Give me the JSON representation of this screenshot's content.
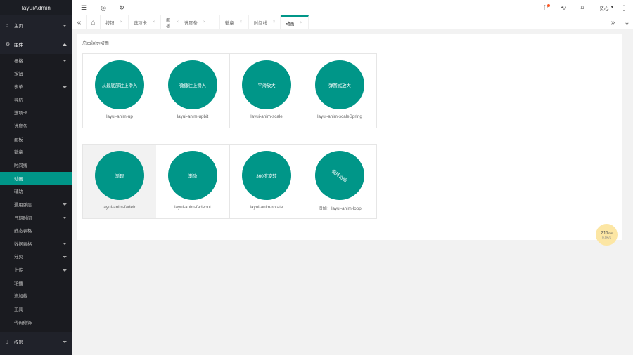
{
  "app": {
    "title": "layuiAdmin"
  },
  "sidebar": {
    "home_label": "主页",
    "components_label": "组件",
    "permissions_label": "权限",
    "items": [
      {
        "label": "栅格",
        "expandable": true
      },
      {
        "label": "按钮",
        "expandable": false
      },
      {
        "label": "表单",
        "expandable": true
      },
      {
        "label": "导航",
        "expandable": false
      },
      {
        "label": "选项卡",
        "expandable": false
      },
      {
        "label": "进度条",
        "expandable": false
      },
      {
        "label": "面板",
        "expandable": false
      },
      {
        "label": "徽章",
        "expandable": false
      },
      {
        "label": "时间线",
        "expandable": false
      },
      {
        "label": "动画",
        "expandable": false,
        "active": true
      },
      {
        "label": "辅助",
        "expandable": false
      },
      {
        "label": "通用弹层",
        "expandable": true
      },
      {
        "label": "日期时间",
        "expandable": true
      },
      {
        "label": "静态表格",
        "expandable": false
      },
      {
        "label": "数据表格",
        "expandable": true
      },
      {
        "label": "分页",
        "expandable": true
      },
      {
        "label": "上传",
        "expandable": true
      },
      {
        "label": "轮播",
        "expandable": false
      },
      {
        "label": "流加载",
        "expandable": false
      },
      {
        "label": "工具",
        "expandable": false
      },
      {
        "label": "代码修饰",
        "expandable": false
      }
    ]
  },
  "header": {
    "user": "贤心",
    "icons": [
      "menu-icon",
      "globe-icon",
      "refresh-icon",
      "bell-icon",
      "theme-icon",
      "tag-icon",
      "more-icon"
    ]
  },
  "tabs": [
    {
      "label": "按钮",
      "active": false
    },
    {
      "label": "选项卡",
      "active": false
    },
    {
      "label": "面板",
      "active": false
    },
    {
      "label": "进度条",
      "active": false
    },
    {
      "label": "徽章",
      "active": false
    },
    {
      "label": "时间线",
      "active": false
    },
    {
      "label": "动画",
      "active": true
    }
  ],
  "close_glyph": "×",
  "main": {
    "hint": "点击演示动画",
    "anims": [
      {
        "text": "从最底部往上滑入",
        "caption": "layui-anim-up"
      },
      {
        "text": "微微往上滑入",
        "caption": "layui-anim-upbit"
      },
      {
        "text": "平滑放大",
        "caption": "layui-anim-scale"
      },
      {
        "text": "弹簧式放大",
        "caption": "layui-anim-scaleSpring"
      },
      {
        "text": "渐现",
        "caption": "layui-anim-fadein"
      },
      {
        "text": "渐隐",
        "caption": "layui-anim-fadeout"
      },
      {
        "text": "360度旋转",
        "caption": "layui-anim-rotate"
      },
      {
        "text": "循环动画",
        "caption": "追加：layui-anim-loop"
      }
    ]
  },
  "badge": {
    "value": "211",
    "unit": "ms",
    "note": "0.0K/s"
  },
  "colors": {
    "accent": "#009688",
    "sidebar": "#20222a",
    "badge": "#fce6a4",
    "notify": "#ff5722"
  }
}
